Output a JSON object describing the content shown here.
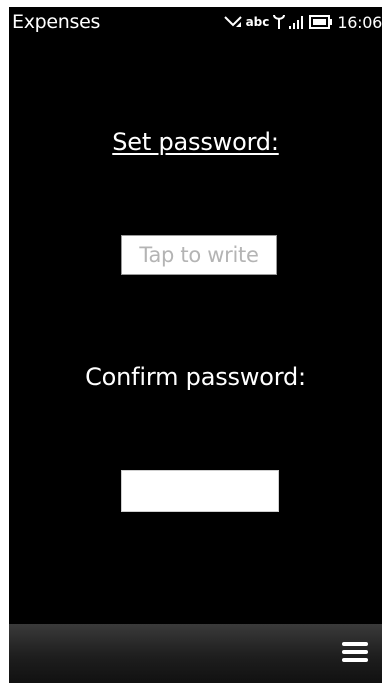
{
  "status_bar": {
    "app_title": "Expenses",
    "input_mode": "abc",
    "time": "16:06",
    "icons": [
      "message-indicator-icon",
      "antenna-icon",
      "signal-strength-icon",
      "battery-icon"
    ]
  },
  "form": {
    "set_password_label": "Set password:",
    "password_placeholder": "Tap to write",
    "confirm_password_label": "Confirm password:",
    "confirm_password_value": ""
  },
  "toolbar": {
    "menu_icon": "menu-icon"
  },
  "colors": {
    "screen_background": "#000000",
    "text": "#ffffff",
    "placeholder": "#b4b4b4",
    "field_background": "#ffffff",
    "toolbar": "#1e1e1e"
  }
}
